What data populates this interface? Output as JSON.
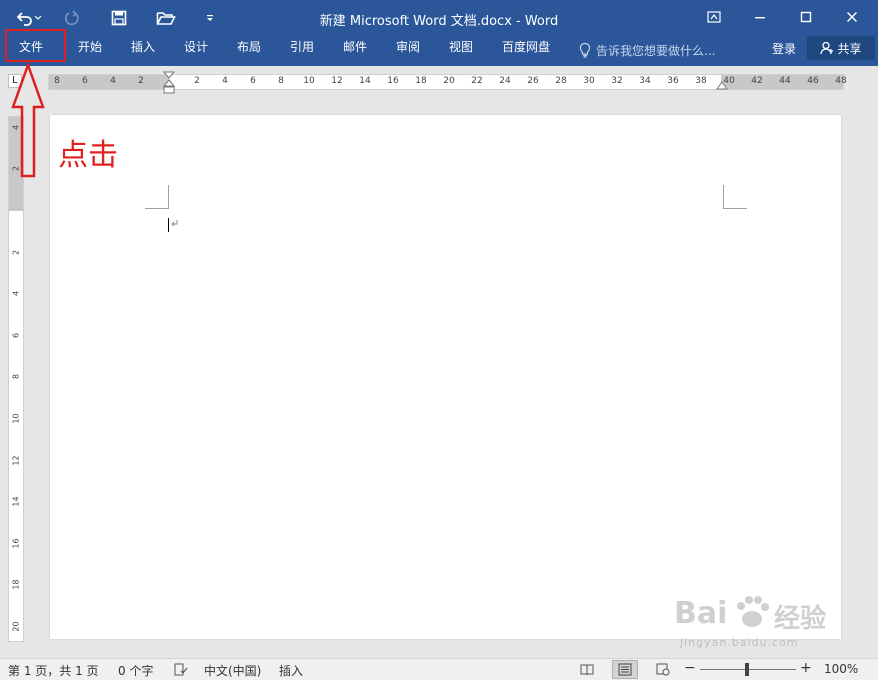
{
  "titlebar": {
    "title": "新建 Microsoft Word 文档.docx - Word",
    "undo_icon": "undo-icon",
    "redo_icon": "redo-icon",
    "save_icon": "save-icon",
    "open_icon": "folder-open-icon",
    "customize_icon": "chevron-down-icon"
  },
  "ribbon": {
    "tabs": [
      {
        "label": "文件"
      },
      {
        "label": "开始"
      },
      {
        "label": "插入"
      },
      {
        "label": "设计"
      },
      {
        "label": "布局"
      },
      {
        "label": "引用"
      },
      {
        "label": "邮件"
      },
      {
        "label": "审阅"
      },
      {
        "label": "视图"
      },
      {
        "label": "百度网盘"
      }
    ],
    "tell_me": "告诉我您想要做什么...",
    "login": "登录",
    "share": "共享"
  },
  "ruler": {
    "corner": "L",
    "h_left": [
      "8",
      "6",
      "4",
      "2"
    ],
    "h_right": [
      "2",
      "4",
      "6",
      "8",
      "10",
      "12",
      "14",
      "16",
      "18",
      "20",
      "22",
      "24",
      "26",
      "28",
      "30",
      "32",
      "34",
      "36",
      "38",
      "40",
      "42",
      "44",
      "46",
      "48"
    ],
    "v_top": [
      "4",
      "2"
    ],
    "v_body": [
      "2",
      "4",
      "6",
      "8",
      "10",
      "12",
      "14",
      "16",
      "18",
      "20"
    ]
  },
  "annotation": {
    "text": "点击"
  },
  "statusbar": {
    "page": "第 1 页，共 1 页",
    "words": "0 个字",
    "language": "中文(中国)",
    "mode": "插入",
    "zoom": "100%",
    "zoom_level_percent": 100
  },
  "watermark": {
    "brand": "Bai",
    "brand_tail": "经验",
    "url": "jingyan.baidu.com"
  },
  "colors": {
    "ribbon_blue": "#2b579a",
    "annotation_red": "#e02020"
  }
}
